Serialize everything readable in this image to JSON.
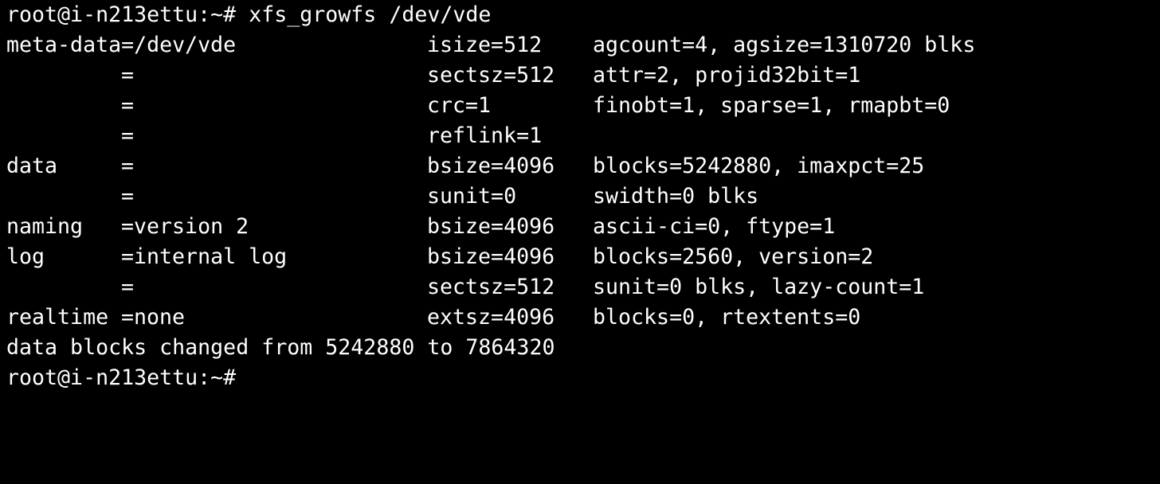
{
  "terminal": {
    "background": "#000000",
    "foreground": "#ffffff",
    "command_line": "root@i-n213ettu:~# xfs_growfs /dev/vde",
    "rows": [
      {
        "section": "meta-data=/dev/vde",
        "eq": "",
        "param": "isize=512",
        "detail": "agcount=4, agsize=1310720 blks"
      },
      {
        "section": "",
        "eq": "=",
        "param": "sectsz=512",
        "detail": "attr=2, projid32bit=1"
      },
      {
        "section": "",
        "eq": "=",
        "param": "crc=1",
        "detail": "finobt=1, sparse=1, rmapbt=0"
      },
      {
        "section": "",
        "eq": "=",
        "param": "reflink=1",
        "detail": ""
      },
      {
        "section": "data",
        "eq": "=",
        "param": "bsize=4096",
        "detail": "blocks=5242880, imaxpct=25"
      },
      {
        "section": "",
        "eq": "=",
        "param": "sunit=0",
        "detail": "swidth=0 blks"
      },
      {
        "section": "naming",
        "eq": "=version 2",
        "param": "bsize=4096",
        "detail": "ascii-ci=0, ftype=1"
      },
      {
        "section": "log",
        "eq": "=internal log",
        "param": "bsize=4096",
        "detail": "blocks=2560, version=2"
      },
      {
        "section": "",
        "eq": "=",
        "param": "sectsz=512",
        "detail": "sunit=0 blks, lazy-count=1"
      },
      {
        "section": "realtime",
        "eq": "=none",
        "param": "extsz=4096",
        "detail": "blocks=0, rtextents=0"
      }
    ],
    "summary_line": "data blocks changed from 5242880 to 7864320",
    "prompt_line": "root@i-n213ettu:~#"
  }
}
